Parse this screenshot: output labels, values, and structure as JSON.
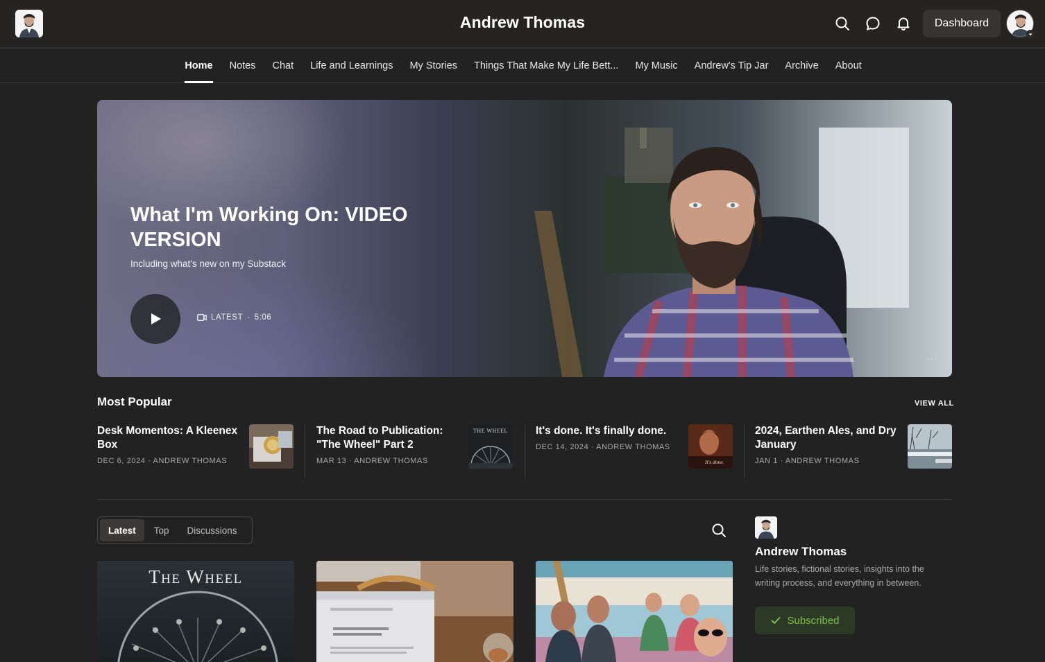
{
  "header": {
    "site_title": "Andrew Thomas",
    "dashboard_label": "Dashboard",
    "icons": [
      "search-icon",
      "chat-bubble-icon",
      "bell-icon"
    ]
  },
  "nav": {
    "items": [
      {
        "label": "Home",
        "active": true
      },
      {
        "label": "Notes"
      },
      {
        "label": "Chat"
      },
      {
        "label": "Life and Learnings"
      },
      {
        "label": "My Stories"
      },
      {
        "label": "Things That Make My Life Bett..."
      },
      {
        "label": "My Music"
      },
      {
        "label": "Andrew's Tip Jar"
      },
      {
        "label": "Archive"
      },
      {
        "label": "About"
      }
    ]
  },
  "hero": {
    "title": "What I'm Working On: VIDEO VERSION",
    "subtitle": "Including what's new on my Substack",
    "meta_label": "LATEST",
    "meta_sep": "·",
    "duration": "5:06",
    "more_label": "..."
  },
  "most_popular": {
    "heading": "Most Popular",
    "view_all": "VIEW ALL",
    "items": [
      {
        "title": "Desk Momentos: A Kleenex Box",
        "meta": "DEC 6, 2024 · ANDREW THOMAS"
      },
      {
        "title": "The Road to Publication: \"The Wheel\" Part 2",
        "meta": "MAR 13 · ANDREW THOMAS",
        "thumb_text": "THE WHEEL"
      },
      {
        "title": "It's done. It's finally done.",
        "meta": "DEC 14, 2024 · ANDREW THOMAS",
        "thumb_text": "It's done."
      },
      {
        "title": "2024, Earthen Ales, and Dry January",
        "meta": "JAN 1 · ANDREW THOMAS"
      }
    ]
  },
  "posts": {
    "tabs": [
      {
        "label": "Latest",
        "active": true
      },
      {
        "label": "Top"
      },
      {
        "label": "Discussions"
      }
    ],
    "cards": [
      {
        "cover_title": "The Wheel"
      }
    ]
  },
  "sidebar": {
    "name": "Andrew Thomas",
    "description": "Life stories, fictional stories, insights into the writing process, and everything in between.",
    "subscribed_label": "Subscribed"
  },
  "colors": {
    "background": "#232222",
    "subscribed_text": "#7cc24c",
    "subscribed_bg": "#2c3a25"
  }
}
